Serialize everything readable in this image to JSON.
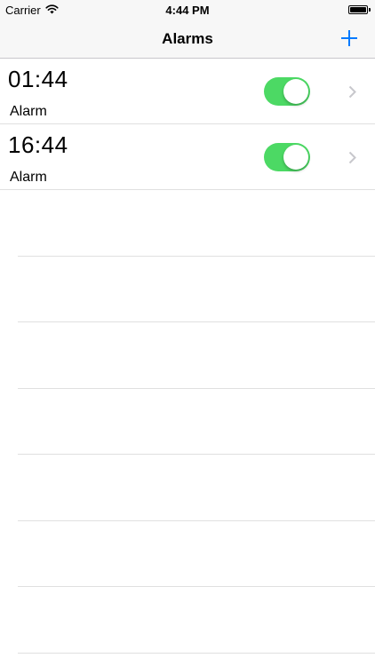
{
  "status_bar": {
    "carrier": "Carrier",
    "time": "4:44 PM",
    "wifi_icon": "wifi-icon",
    "battery_icon": "battery-icon"
  },
  "nav_bar": {
    "title": "Alarms",
    "add_icon": "plus-icon"
  },
  "colors": {
    "accent": "#007aff",
    "toggle_on": "#4cd964",
    "separator": "#e0e0e0",
    "bar_background": "#f7f7f7"
  },
  "alarms": [
    {
      "time": "01:44",
      "label": "Alarm",
      "enabled": true
    },
    {
      "time": "16:44",
      "label": "Alarm",
      "enabled": true
    }
  ]
}
